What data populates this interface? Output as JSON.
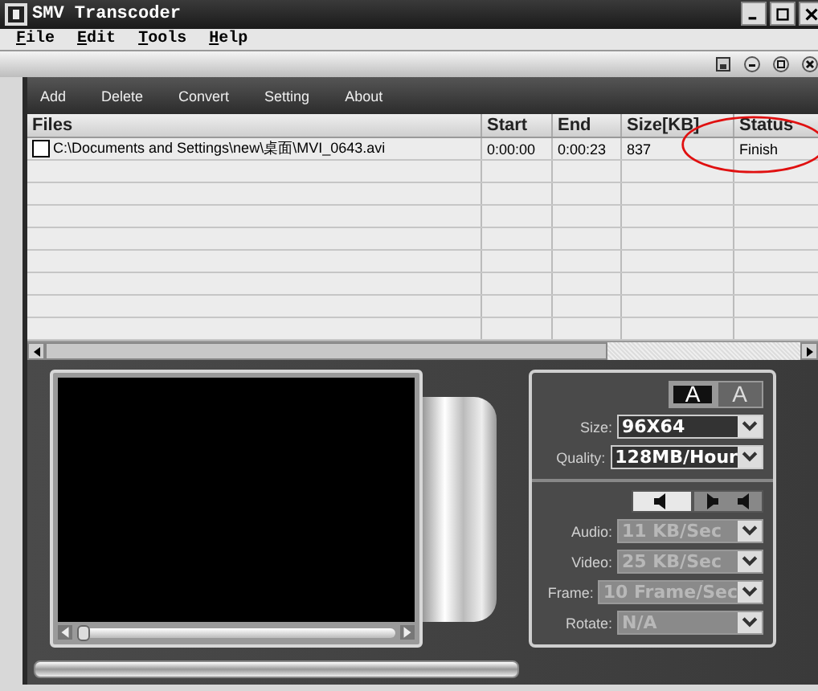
{
  "window": {
    "title": "SMV Transcoder"
  },
  "menu": [
    {
      "label": "File"
    },
    {
      "label": "Edit"
    },
    {
      "label": "Tools"
    },
    {
      "label": "Help"
    }
  ],
  "toolbar": [
    "Add",
    "Delete",
    "Convert",
    "Setting",
    "About"
  ],
  "table": {
    "columns": [
      "Files",
      "Start",
      "End",
      "Size[KB]",
      "Status"
    ],
    "rows": [
      {
        "checked": false,
        "cells": [
          "C:\\Documents and Settings\\new\\桌面\\MVI_0643.avi",
          "0:00:00",
          "0:00:23",
          "837",
          "Finish"
        ]
      }
    ]
  },
  "preview": {
    "seek": {
      "level": 0
    },
    "progress": {
      "level": 0
    }
  },
  "display_modes": [
    {
      "label": "A",
      "selected": true
    },
    {
      "label": "A",
      "selected": false
    }
  ],
  "video_settings": [
    {
      "label": "Size:",
      "value": "96X64",
      "disabled": false
    },
    {
      "label": "Quality:",
      "value": "128MB/Hour",
      "disabled": false
    }
  ],
  "audio_modes": [
    {
      "selected": true
    },
    {
      "selected": false
    }
  ],
  "audio_settings": [
    {
      "label": "Audio:",
      "value": "11 KB/Sec",
      "disabled": true
    },
    {
      "label": "Video:",
      "value": "25 KB/Sec",
      "disabled": true
    },
    {
      "label": "Frame:",
      "value": "10 Frame/Sec",
      "disabled": true
    },
    {
      "label": "Rotate:",
      "value": "N/A",
      "disabled": true
    }
  ]
}
